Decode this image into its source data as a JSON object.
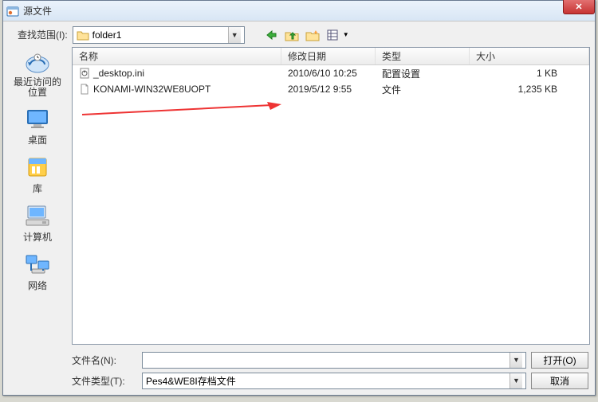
{
  "title": "源文件",
  "lookup": {
    "label": "查找范围(I):",
    "folder": "folder1"
  },
  "columns": {
    "name": "名称",
    "date": "修改日期",
    "type": "类型",
    "size": "大小"
  },
  "rows": [
    {
      "name": "_desktop.ini",
      "date": "2010/6/10 10:25",
      "type": "配置设置",
      "size": "1 KB"
    },
    {
      "name": "KONAMI-WIN32WE8UOPT",
      "date": "2019/5/12 9:55",
      "type": "文件",
      "size": "1,235 KB"
    }
  ],
  "places": {
    "recent": "最近访问的位置",
    "desktop": "桌面",
    "libraries": "库",
    "computer": "计算机",
    "network": "网络"
  },
  "bottom": {
    "filename_label": "文件名(N):",
    "filename_value": "",
    "filetype_label": "文件类型(T):",
    "filetype_value": "Pes4&WE8I存档文件",
    "open": "打开(O)",
    "cancel": "取消"
  }
}
